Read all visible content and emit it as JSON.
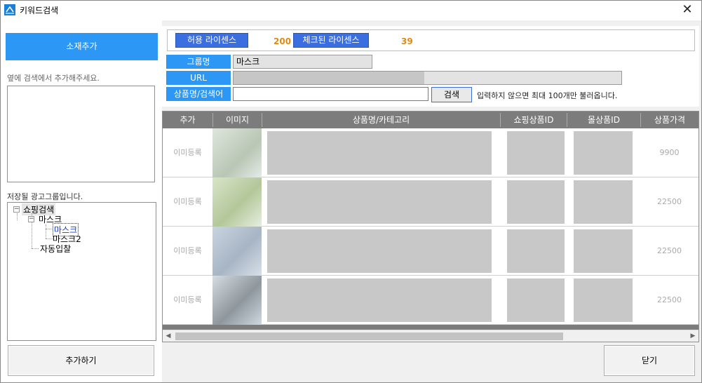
{
  "window": {
    "title": "키워드검색"
  },
  "left": {
    "add_material": "소재추가",
    "hint_top": "옆에 검색에서 추가해주세요.",
    "hint_tree": "저장될 광고그룹입니다.",
    "tree": {
      "root": "쇼핑검색",
      "child": "마스크",
      "leaf1": "마스크",
      "leaf2": "마스크2",
      "other": "자동입찰"
    },
    "add_button": "추가하기"
  },
  "license": {
    "allowed_label": "허용 라이센스",
    "allowed_value": "200",
    "checked_label": "체크된 라이센스",
    "checked_value": "39"
  },
  "form": {
    "group_label": "그룹명",
    "group_value": "마스크",
    "url_label": "URL",
    "product_label": "상품명/검색어",
    "product_value": "",
    "search_button": "검색",
    "search_note": "입력하지 않으면 최대 100개만 불러옵니다."
  },
  "table": {
    "headers": [
      "추가",
      "이미지",
      "상품명/카테고리",
      "쇼핑상품ID",
      "몰상품ID",
      "상품가격"
    ],
    "rows": [
      {
        "add": "이미등록",
        "price": "9900"
      },
      {
        "add": "이미등록",
        "price": "22500"
      },
      {
        "add": "이미등록",
        "price": "22500"
      },
      {
        "add": "이미등록",
        "price": "22500"
      }
    ]
  },
  "close_button": "닫기",
  "colors": {
    "accent": "#2c97f5",
    "license_label": "#3b6fe0",
    "license_value": "#e38a0b",
    "header": "#7c7c7c"
  }
}
